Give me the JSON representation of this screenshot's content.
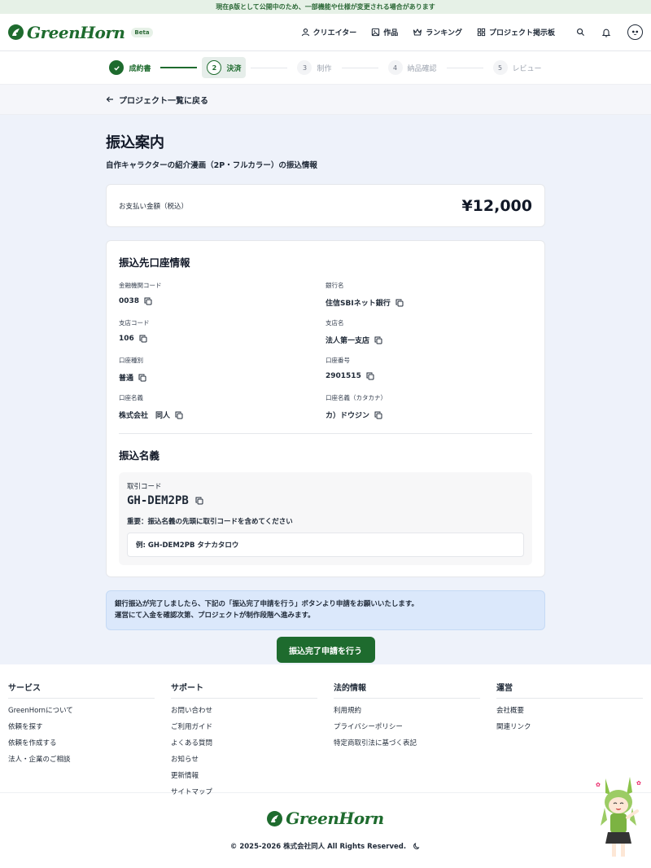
{
  "banner": "現在β版として公開中のため、一部機能や仕様が変更される場合があります",
  "header": {
    "logo_text": "GreenHorn",
    "beta_badge": "Beta",
    "nav": [
      {
        "label": "クリエイター",
        "icon": "user-icon"
      },
      {
        "label": "作品",
        "icon": "image-icon"
      },
      {
        "label": "ランキング",
        "icon": "crown-icon"
      },
      {
        "label": "プロジェクト掲示板",
        "icon": "grid-icon"
      }
    ]
  },
  "stepper": [
    {
      "num": "✓",
      "label": "成約書",
      "state": "done"
    },
    {
      "num": "2",
      "label": "決済",
      "state": "active"
    },
    {
      "num": "3",
      "label": "制作",
      "state": "pending"
    },
    {
      "num": "4",
      "label": "納品確認",
      "state": "pending"
    },
    {
      "num": "5",
      "label": "レビュー",
      "state": "pending"
    }
  ],
  "back_link": "プロジェクト一覧に戻る",
  "page": {
    "title": "振込案内",
    "subtitle": "自作キャラクターの紹介漫画（2P・フルカラー）の振込情報"
  },
  "payment": {
    "label": "お支払い金額（税込）",
    "amount": "¥12,000"
  },
  "bank": {
    "title": "振込先口座情報",
    "fields": [
      {
        "label": "金融機関コード",
        "value": "0038"
      },
      {
        "label": "銀行名",
        "value": "住信SBIネット銀行"
      },
      {
        "label": "支店コード",
        "value": "106"
      },
      {
        "label": "支店名",
        "value": "法人第一支店"
      },
      {
        "label": "口座種別",
        "value": "普通"
      },
      {
        "label": "口座番号",
        "value": "2901515"
      },
      {
        "label": "口座名義",
        "value": "株式会社　同人"
      },
      {
        "label": "口座名義（カタカナ）",
        "value": "カ）ドウジン"
      }
    ]
  },
  "transfer_name": {
    "title": "振込名義",
    "code_label": "取引コード",
    "code": "GH-DEM2PB",
    "notice": "重要：振込名義の先頭に取引コードを含めてください",
    "example": "例:  GH-DEM2PB タナカタロウ"
  },
  "info": {
    "line1": "銀行振込が完了しましたら、下記の「振込完了申請を行う」ボタンより申請をお願いいたします。",
    "line2": "運営にて入金を確認次第、プロジェクトが制作段階へ進みます。"
  },
  "submit_button": "振込完了申請を行う",
  "footer": {
    "columns": [
      {
        "title": "サービス",
        "links": [
          "GreenHornについて",
          "依頼を探す",
          "依頼を作成する",
          "法人・企業のご相談"
        ]
      },
      {
        "title": "サポート",
        "links": [
          "お問い合わせ",
          "ご利用ガイド",
          "よくある質問",
          "お知らせ",
          "更新情報",
          "サイトマップ"
        ]
      },
      {
        "title": "法的情報",
        "links": [
          "利用規約",
          "プライバシーポリシー",
          "特定商取引法に基づく表記"
        ]
      },
      {
        "title": "運営",
        "links": [
          "会社概要",
          "関連リンク"
        ]
      }
    ],
    "logo_text": "GreenHorn",
    "copyright": "© 2025-2026 株式会社同人 All Rights Reserved."
  },
  "colors": {
    "brand": "#1e6b2e",
    "background": "#eef2fa",
    "info_bg": "#dbe8fb"
  }
}
